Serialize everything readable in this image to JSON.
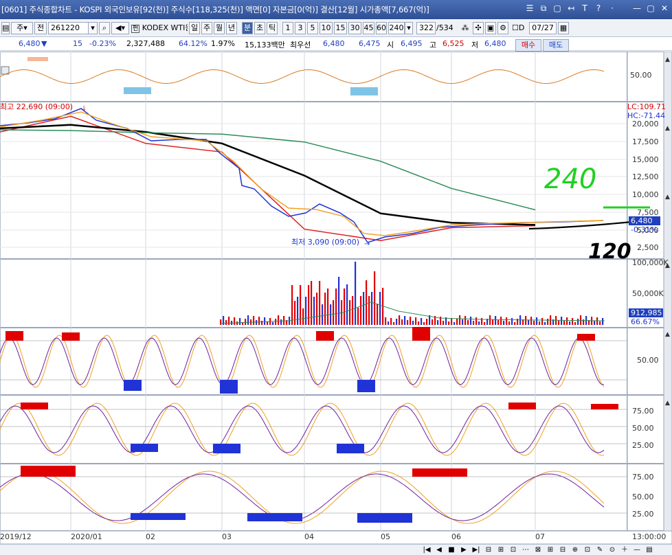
{
  "window": {
    "title": "[0601] 주식종합차트 - KOSPI 외국인보유[92(천)] 주식수[118,325(천)] 액면[0] 자본금[0(억)] 결산[12월] 시가총액[7,667(억)]",
    "controls": [
      "☰",
      "⧉",
      "▢",
      "↤",
      "T",
      "?",
      "·",
      "—",
      "▢",
      "✕"
    ]
  },
  "toolbar": {
    "mode_label": "주",
    "prev_label": "전",
    "code": "261220",
    "stock_name": "KODEX WTI원",
    "periods": [
      "일",
      "주",
      "월",
      "년",
      "분",
      "초",
      "틱"
    ],
    "active_period": "분",
    "intervals": [
      "1",
      "3",
      "5",
      "10",
      "15",
      "30",
      "45",
      "60"
    ],
    "interval_value": "240",
    "count": "322",
    "total": "/534",
    "date_check": "D",
    "date": "07/27"
  },
  "quote": {
    "price": "6,480",
    "down_arrow": "▼",
    "change": "15",
    "change_pct": "-0.23%",
    "volume": "2,327,488",
    "vol_ratio": "64.12%",
    "turnover": "1.97%",
    "amount": "15,133백만",
    "priority_label": "최우선",
    "best_ask": "6,480",
    "best_bid": "6,475",
    "open_label": "시",
    "open": "6,495",
    "high_label": "고",
    "high": "6,525",
    "low_label": "저",
    "low": "6,480",
    "buy_label": "매수",
    "sell_label": "매도"
  },
  "colors": {
    "accent": "#2e4f95",
    "up": "#e00000",
    "down": "#1f33d6",
    "ma_orange": "#f0a020",
    "ma_red": "#e02020",
    "ma_black": "#000000",
    "ma_green": "#2e8b57",
    "annotation_green": "#20d020"
  },
  "annotations": {
    "high": "최고 22,690 (09:00)",
    "low": "최저 3,090 (09:00)",
    "hand_240": "240",
    "hand_120": "120"
  },
  "axes": {
    "osc1": [
      "50.00"
    ],
    "price": [
      "LC:109.71",
      "HC:-71.44",
      "20,000",
      "17,500",
      "15,000",
      "12,500",
      "10,000",
      "7,500",
      "5,000",
      "2,500"
    ],
    "price_tag": "6,480",
    "price_pct": "-0.31%",
    "volume": [
      "100,000K",
      "50,000K"
    ],
    "vol_tag": "912,985",
    "vol_pct": "66.67%",
    "osc3": [
      "50.00"
    ],
    "osc4": [
      "75.00",
      "50.00",
      "25.00"
    ],
    "osc5": [
      "75.00",
      "50.00",
      "25.00"
    ],
    "x_labels": [
      "2019/12",
      "2020/01",
      "02",
      "03",
      "04",
      "05",
      "06",
      "07"
    ],
    "time_right": "13:00:00"
  },
  "chart_data": {
    "type": "line",
    "x": [
      "2019/12",
      "2020/01",
      "02",
      "03",
      "04",
      "05",
      "06",
      "07"
    ],
    "series": [
      {
        "values": [
          19600,
          21800,
          18000,
          16800,
          6000,
          4400,
          6200,
          6480
        ]
      },
      {
        "values": [
          20100,
          20600,
          19600,
          18000,
          13500,
          8200,
          6900,
          6600
        ]
      },
      {
        "values": [
          19900,
          19800,
          19500,
          19300,
          18200,
          15500,
          11700,
          8700
        ]
      }
    ],
    "ylim": [
      2500,
      22690
    ]
  },
  "statusbar": {
    "buttons": [
      "|◀",
      "◀",
      "■",
      "▶",
      "▶|",
      "⊟",
      "⊞",
      "⊡",
      "⋯",
      "⊠",
      "⊞",
      "⊟",
      "⊕",
      "⊡",
      "✎",
      "⊙",
      "＋",
      "—",
      "▤"
    ]
  }
}
